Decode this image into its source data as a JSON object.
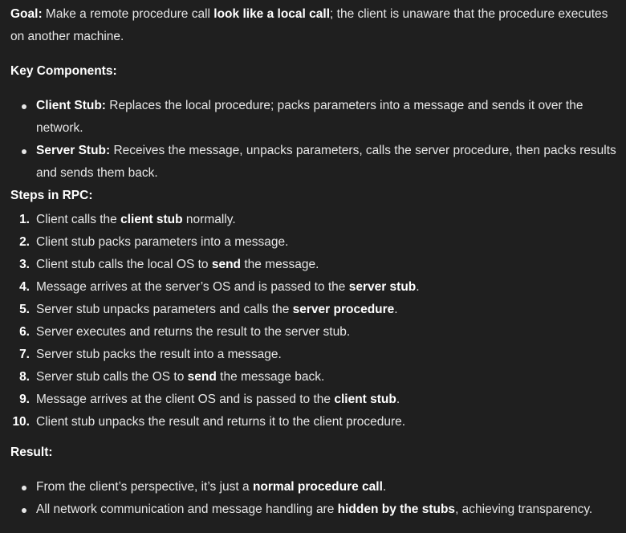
{
  "goal": {
    "label": "Goal:",
    "pre": " Make a remote procedure call ",
    "bold": "look like a local call",
    "post": "; the client is unaware that the procedure executes on another machine."
  },
  "key_components": {
    "heading": "Key Components:",
    "items": [
      {
        "label": "Client Stub:",
        "text": " Replaces the local procedure; packs parameters into a message and sends it over the network."
      },
      {
        "label": "Server Stub:",
        "text": " Receives the message, unpacks parameters, calls the server procedure, then packs results and sends them back."
      }
    ]
  },
  "steps": {
    "heading": "Steps in RPC:",
    "items": [
      {
        "num": "1.",
        "pre": "Client calls the ",
        "bold": "client stub",
        "post": " normally."
      },
      {
        "num": "2.",
        "pre": "Client stub packs parameters into a message.",
        "bold": "",
        "post": ""
      },
      {
        "num": "3.",
        "pre": "Client stub calls the local OS to ",
        "bold": "send",
        "post": " the message."
      },
      {
        "num": "4.",
        "pre": "Message arrives at the server’s OS and is passed to the ",
        "bold": "server stub",
        "post": "."
      },
      {
        "num": "5.",
        "pre": "Server stub unpacks parameters and calls the ",
        "bold": "server procedure",
        "post": "."
      },
      {
        "num": "6.",
        "pre": "Server executes and returns the result to the server stub.",
        "bold": "",
        "post": ""
      },
      {
        "num": "7.",
        "pre": "Server stub packs the result into a message.",
        "bold": "",
        "post": ""
      },
      {
        "num": "8.",
        "pre": "Server stub calls the OS to ",
        "bold": "send",
        "post": " the message back."
      },
      {
        "num": "9.",
        "pre": "Message arrives at the client OS and is passed to the ",
        "bold": "client stub",
        "post": "."
      },
      {
        "num": "10.",
        "pre": "Client stub unpacks the result and returns it to the client procedure.",
        "bold": "",
        "post": ""
      }
    ]
  },
  "result": {
    "heading": "Result:",
    "items": [
      {
        "pre": "From the client’s perspective, it’s just a ",
        "bold": "normal procedure call",
        "post": "."
      },
      {
        "pre": "All network communication and message handling are ",
        "bold": "hidden by the stubs",
        "post": ", achieving transparency."
      }
    ]
  }
}
